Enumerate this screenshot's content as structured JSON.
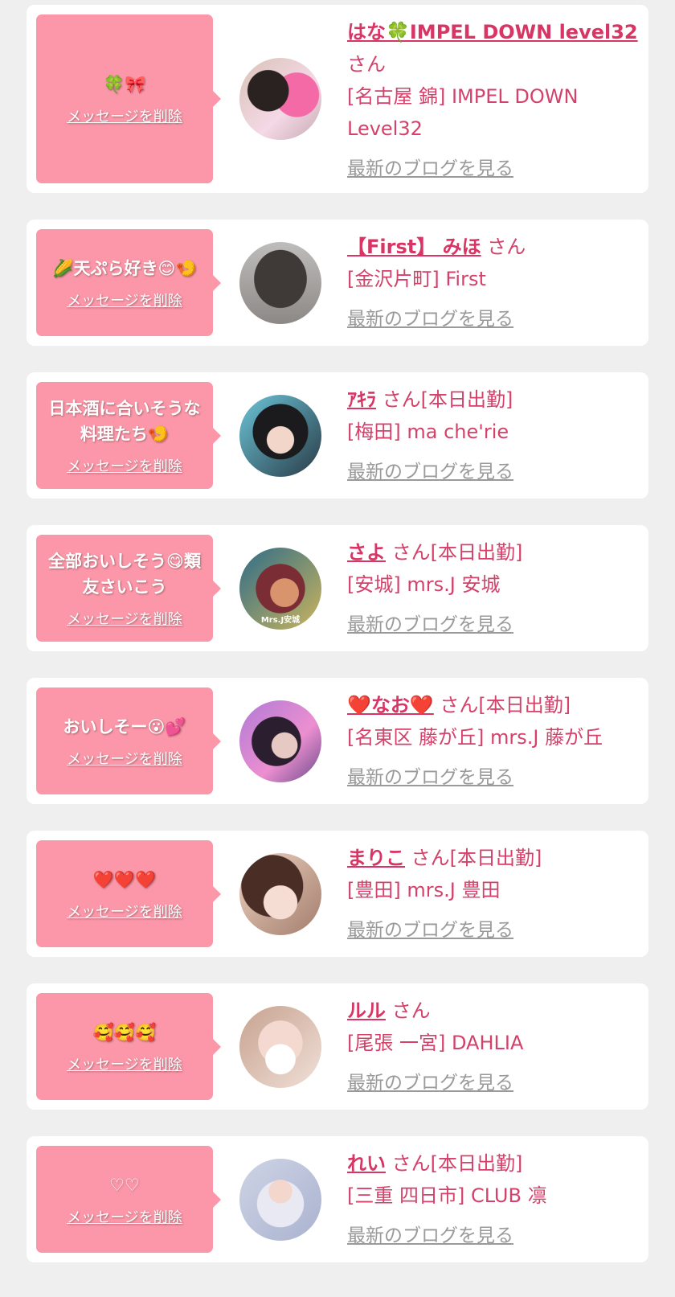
{
  "delete_label": "メッセージを削除",
  "blog_label": "最新のブログを見る",
  "accent_colors": {
    "bubble": "#fb97a8",
    "name": "#d83565",
    "text": "#d4416a",
    "blog_link": "#9a9a9a"
  },
  "cards": [
    {
      "message": "🍀🎀",
      "name": "はな🍀IMPEL DOWN level32",
      "suffix": "さん",
      "shop": "[名古屋 錦] IMPEL DOWN Level32",
      "avatar_icon": "profile-photo-icon",
      "avatar_label": ""
    },
    {
      "message": "🌽天ぷら好き😊🍤",
      "name": "【First】 みほ",
      "suffix": " さん",
      "shop": "[金沢片町] First",
      "avatar_icon": "profile-photo-icon",
      "avatar_label": ""
    },
    {
      "message": "日本酒に合いそうな料理たち🍤",
      "name": "ｱｷﾗ",
      "suffix": " さん[本日出勤]",
      "shop": "[梅田] ma che'rie",
      "avatar_icon": "profile-photo-icon",
      "avatar_label": ""
    },
    {
      "message": "全部おいしそう😋類友さいこう",
      "name": "さよ",
      "suffix": " さん[本日出勤]",
      "shop": "[安城] mrs.J 安城",
      "avatar_icon": "profile-photo-icon",
      "avatar_label": "Mrs.J安城"
    },
    {
      "message": "おいしそー😮💕",
      "name": "❤️なお❤️",
      "suffix": " さん[本日出勤]",
      "shop": "[名東区 藤が丘] mrs.J 藤が丘",
      "avatar_icon": "profile-photo-icon",
      "avatar_label": ""
    },
    {
      "message": "❤️❤️❤️",
      "name": "まりこ",
      "suffix": " さん[本日出勤]",
      "shop": "[豊田] mrs.J 豊田",
      "avatar_icon": "profile-photo-icon",
      "avatar_label": ""
    },
    {
      "message": "🥰🥰🥰",
      "name": "ルル",
      "suffix": " さん",
      "shop": "[尾張 一宮] DAHLIA",
      "avatar_icon": "profile-photo-icon",
      "avatar_label": ""
    },
    {
      "message": "♡♡",
      "name": "れい",
      "suffix": " さん[本日出勤]",
      "shop": "[三重 四日市] CLUB 凛",
      "avatar_icon": "profile-photo-icon",
      "avatar_label": ""
    }
  ]
}
